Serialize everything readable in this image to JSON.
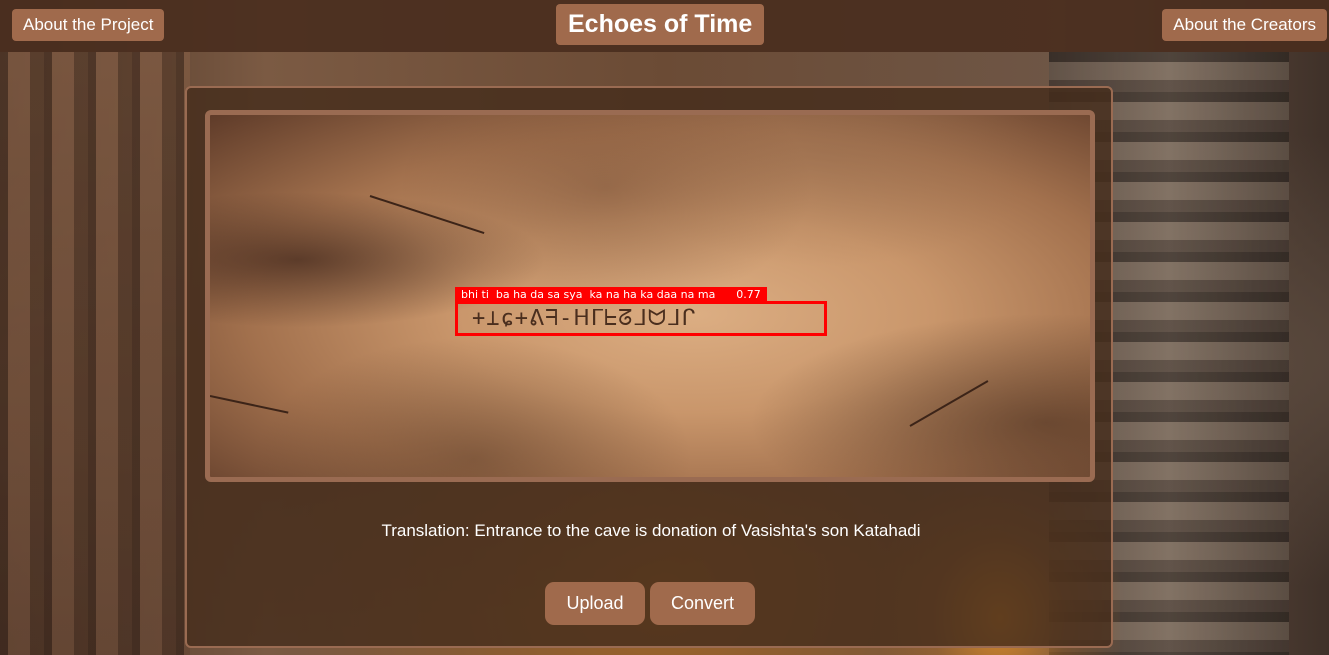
{
  "header": {
    "title": "Echoes of Time",
    "nav_left_label": "About the Project",
    "nav_right_label": "About the Creators"
  },
  "inscription": {
    "detection_label": "bhi ti  ba ha da sa sya  ka na ha ka daa na ma      0.77",
    "script_glyphs": "+⊥ɕ+ᕕᖷ-ᕼᒥᖶᘔᒧᗢᒧᒋ",
    "detection_color": "#ff0000"
  },
  "result": {
    "translation_text": "Translation: Entrance to the cave is donation of Vasishta's son Katahadi"
  },
  "actions": {
    "upload_label": "Upload",
    "convert_label": "Convert"
  },
  "colors": {
    "accent": "#a06a4c",
    "panel_border": "#9a6b52",
    "header_bg": "#4a2e1e"
  }
}
